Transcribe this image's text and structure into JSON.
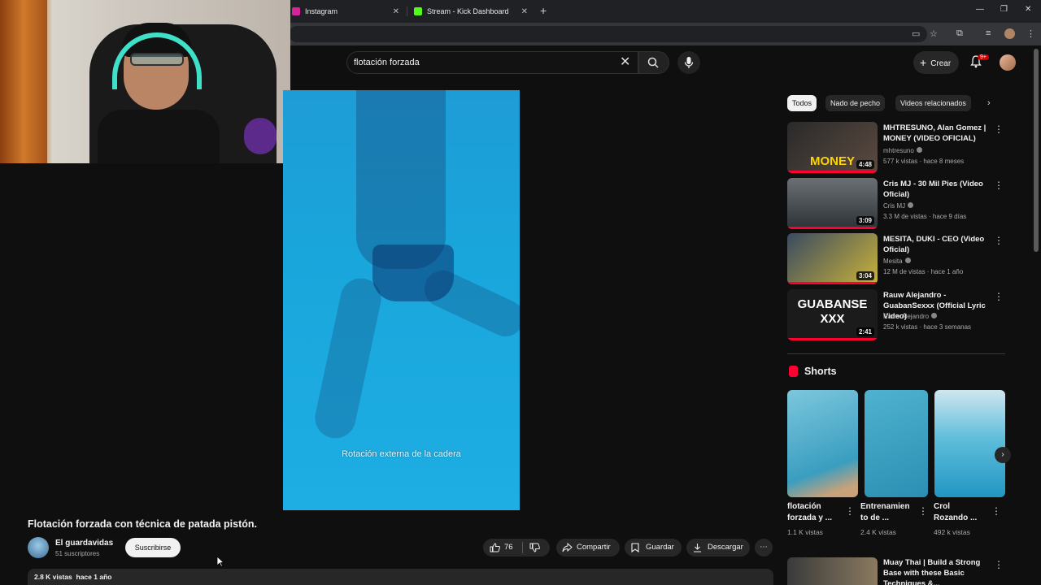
{
  "browser": {
    "tabs": [
      {
        "label": "Instagram"
      },
      {
        "label": "Stream - Kick Dashboard"
      }
    ]
  },
  "search": {
    "value": "flotación forzada"
  },
  "header": {
    "create_label": "Crear",
    "notif_badge": "9+"
  },
  "video": {
    "caption": "Rotación externa de la cadera",
    "title": "Flotación forzada con técnica de patada pistón.",
    "channel": "El guardavidas",
    "subscribers": "51 suscriptores",
    "subscribe_label": "Suscribirse",
    "likes": "76",
    "share_label": "Compartir",
    "save_label": "Guardar",
    "download_label": "Descargar",
    "views": "2.8 K vistas",
    "age": "hace 1 año"
  },
  "sidebar": {
    "chips": [
      "Todos",
      "Nado de pecho",
      "Videos relacionados"
    ],
    "recommendations": [
      {
        "title": "MHTRESUNO, Alan Gomez | MONEY (VIDEO OFICIAL)",
        "channel": "mhtresuno",
        "meta": "577 k vistas · hace 8 meses",
        "duration": "4:48",
        "thumb_text": "MONEY"
      },
      {
        "title": "Cris MJ - 30 Mil Pies (Video Oficial)",
        "channel": "Cris MJ",
        "meta": "3.3 M de vistas · hace 9 días",
        "duration": "3:09",
        "thumb_text": ""
      },
      {
        "title": "MESITA, DUKI - CEO (Video Oficial)",
        "channel": "Mesita",
        "meta": "12 M de vistas · hace 1 año",
        "duration": "3:04",
        "thumb_text": ""
      },
      {
        "title": "Rauw Alejandro - GuabanSexxx (Official Lyric Video)",
        "channel": "Rauw Alejandro",
        "meta": "252 k vistas · hace 3 semanas",
        "duration": "2:41",
        "thumb_text": "GUABANSE XXX"
      }
    ],
    "shorts_heading": "Shorts",
    "shorts": [
      {
        "title": "flotación forzada y ...",
        "views": "1.1 K vistas"
      },
      {
        "title": "Entrenamien to de ...",
        "views": "2.4 K vistas"
      },
      {
        "title": "Crol Rozando ...",
        "views": "492 k vistas"
      }
    ],
    "bottom_rec": {
      "title": "Muay Thai | Build a Strong Base with these Basic Techniques &..."
    }
  }
}
